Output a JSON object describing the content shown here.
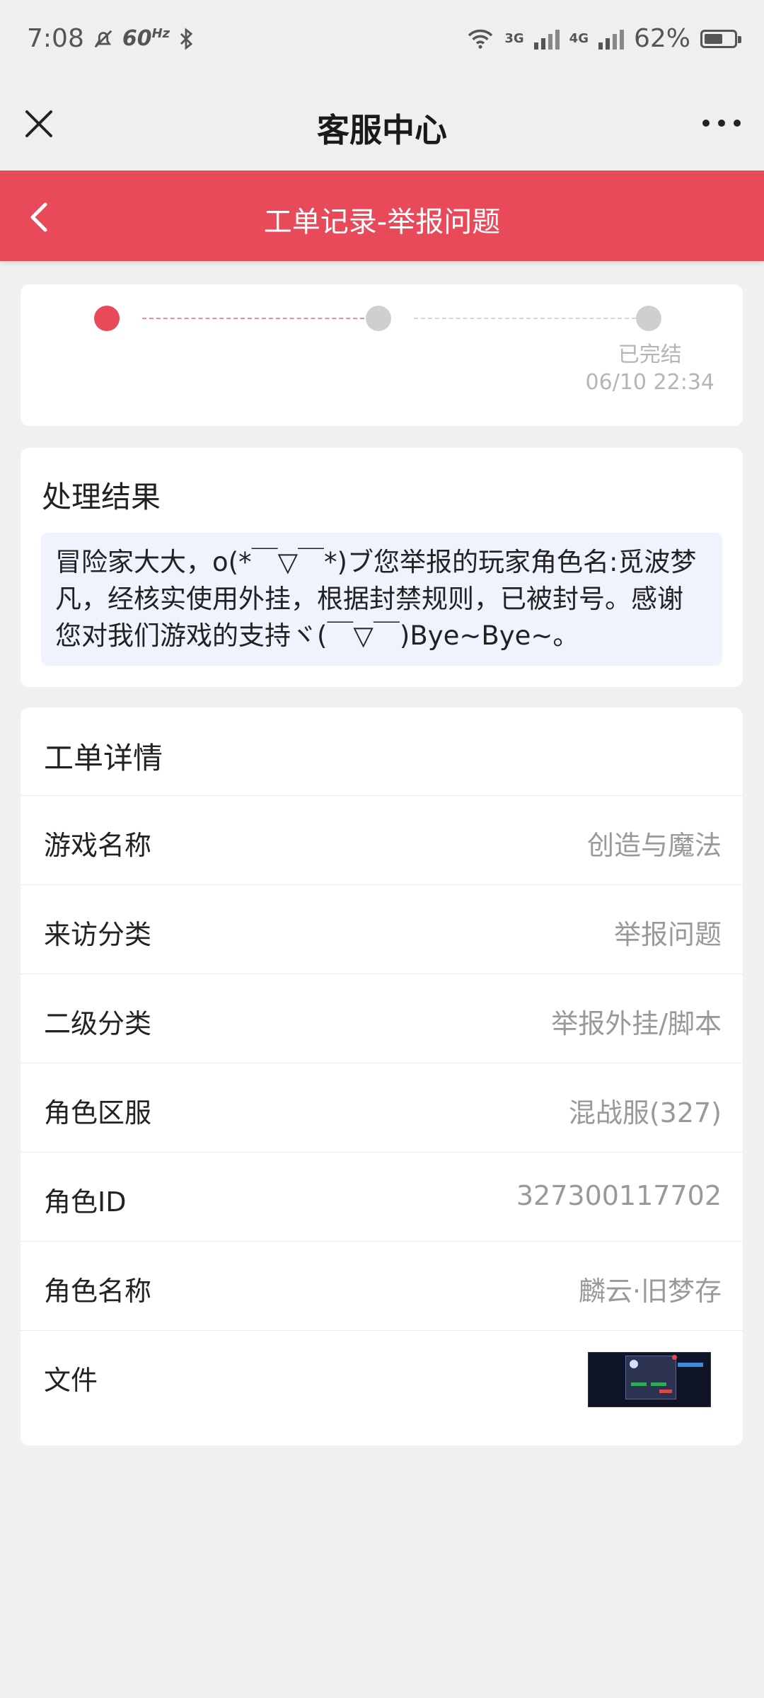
{
  "status_bar": {
    "time": "7:08",
    "refresh_rate": "60",
    "refresh_unit": "Hz",
    "net1": "3G",
    "net2": "4G",
    "battery": "62%",
    "battery_level": 0.62
  },
  "title_bar": {
    "title": "客服中心"
  },
  "header": {
    "title": "工单记录-举报问题"
  },
  "progress": {
    "steps": [
      {
        "state": "active"
      },
      {
        "state": "inactive"
      },
      {
        "state": "inactive",
        "label": "已完结",
        "time": "06/10 22:34"
      }
    ]
  },
  "result": {
    "heading": "处理结果",
    "message": "冒险家大大，o(*￣▽￣*)ブ您举报的玩家角色名:觅波梦凡，经核实使用外挂，根据封禁规则，已被封号。感谢您对我们游戏的支持ヾ(￣▽￣)Bye~Bye~。"
  },
  "details": {
    "heading": "工单详情",
    "rows": [
      {
        "label": "游戏名称",
        "value": "创造与魔法"
      },
      {
        "label": "来访分类",
        "value": "举报问题"
      },
      {
        "label": "二级分类",
        "value": "举报外挂/脚本"
      },
      {
        "label": "角色区服",
        "value": "混战服(327)"
      },
      {
        "label": "角色ID",
        "value": "327300117702"
      },
      {
        "label": "角色名称",
        "value": "麟云·旧梦存"
      },
      {
        "label": "文件",
        "value": ""
      }
    ]
  },
  "colors": {
    "accent": "#e84a5a",
    "message_bg": "#eef3fd",
    "page_bg": "#f0f0f0"
  }
}
